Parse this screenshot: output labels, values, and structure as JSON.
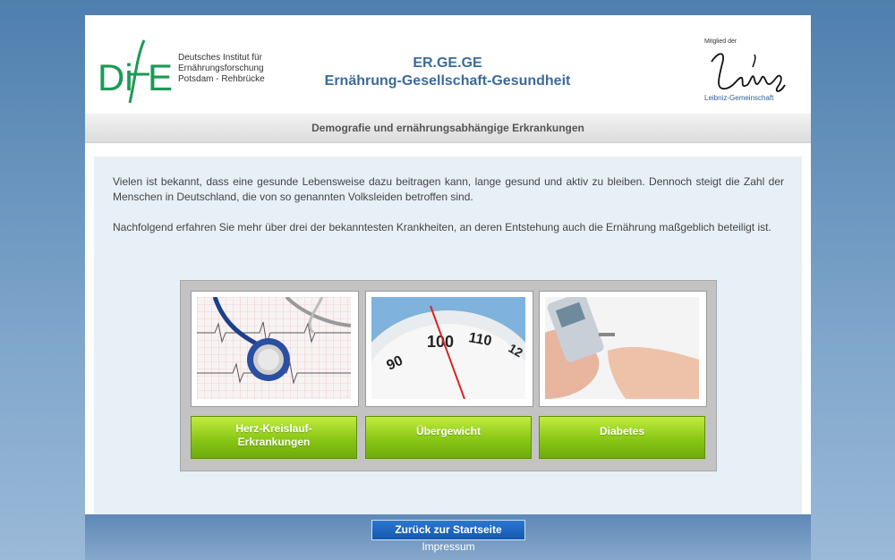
{
  "header": {
    "dife": {
      "mark": "DIfE",
      "lines": [
        "Deutsches Institut für",
        "Ernährungsforschung",
        "Potsdam - Rehbrücke"
      ]
    },
    "title": "ER.GE.GE",
    "subtitle": "Ernährung-Gesellschaft-Gesundheit",
    "leibniz": {
      "member_label": "Mitglied der",
      "signature": "Leibniz",
      "org": "Leibniz-Gemeinschaft"
    }
  },
  "subheader": "Demografie und ernährungsabhängige Erkrankungen",
  "content": {
    "paragraph1": "Vielen ist bekannt, dass eine gesunde Lebensweise dazu beitragen kann, lange gesund und aktiv zu bleiben. Dennoch steigt die Zahl der Menschen in Deutschland, die von so genannten Volksleiden betroffen sind.",
    "paragraph2": "Nachfolgend erfahren Sie mehr über drei der bekanntesten Krankheiten, an deren Entstehung auch die Ernährung maßgeblich beteiligt ist."
  },
  "topics": [
    {
      "label": "Herz-Kreislauf-Erkrankungen",
      "image": "stethoscope-ecg-image"
    },
    {
      "label": "Übergewicht",
      "image": "scale-image"
    },
    {
      "label": "Diabetes",
      "image": "glucose-meter-image"
    }
  ],
  "scale_numbers": [
    "90",
    "100",
    "110",
    "12"
  ],
  "footer": {
    "back_button": "Zurück zur Startseite",
    "impressum": "Impressum"
  },
  "colors": {
    "accent_green": "#89c716",
    "title_blue": "#3b6b9b",
    "logo_green": "#1c9a53",
    "button_blue": "#1558b0"
  }
}
